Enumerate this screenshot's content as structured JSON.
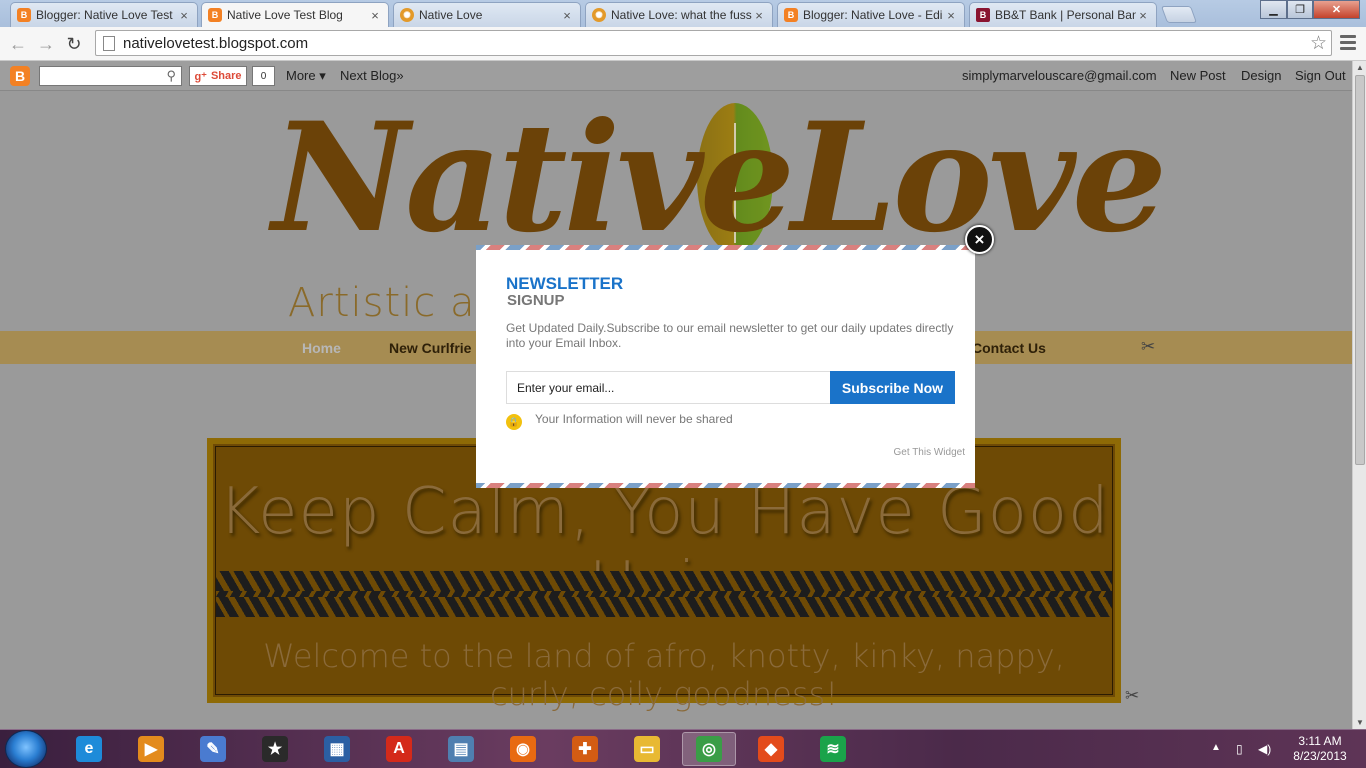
{
  "browser": {
    "tabs": [
      {
        "label": "Blogger: Native Love Test",
        "icon": "blogger-icon",
        "active": false
      },
      {
        "label": "Native Love Test Blog",
        "icon": "blogger-icon",
        "active": true
      },
      {
        "label": "Native Love",
        "icon": "sun-icon",
        "active": false
      },
      {
        "label": "Native Love: what the fuss",
        "icon": "sun-icon",
        "active": false
      },
      {
        "label": "Blogger: Native Love - Edi",
        "icon": "blogger-icon",
        "active": false
      },
      {
        "label": "BB&T Bank | Personal Ban",
        "icon": "bank-icon",
        "active": false
      }
    ],
    "tab_close": "×",
    "url": "nativelovetest.blogspot.com"
  },
  "blogger_bar": {
    "share_label": "Share",
    "share_count": "0",
    "more_label": "More ▾",
    "next_blog_label": "Next Blog»",
    "email": "simplymarvelouscare@gmail.com",
    "new_post_label": "New Post",
    "design_label": "Design",
    "sign_out_label": "Sign Out"
  },
  "blog": {
    "logo_text": "NativeLove",
    "tagline": "Artistic and ... st Hair.",
    "menu": [
      {
        "label": "Home"
      },
      {
        "label": "New Curlfrie"
      },
      {
        "label": "Contact Us"
      }
    ],
    "banner_title": "Keep Calm, You Have Good Hair.",
    "banner_subtitle": "Welcome to the land of afro, knotty, kinky, nappy, curly, coily goodness!"
  },
  "newsletter": {
    "title": "NEWSLETTER",
    "subtitle": "SIGNUP",
    "description": "Get Updated Daily.Subscribe to our email newsletter to get our daily updates directly into your Email Inbox.",
    "email_placeholder": "Enter your email...",
    "subscribe_label": "Subscribe Now",
    "privacy_note": "Your Information will never be shared",
    "get_widget_label": "Get This Widget",
    "close_label": "×"
  },
  "taskbar": {
    "apps": [
      {
        "name": "ie-icon",
        "glyph": "e",
        "color": "#1e8bd9"
      },
      {
        "name": "media-player-icon",
        "glyph": "▶",
        "color": "#e38b1d"
      },
      {
        "name": "paint-icon",
        "glyph": "✎",
        "color": "#4a7bd0"
      },
      {
        "name": "movie-maker-icon",
        "glyph": "★",
        "color": "#2a2a2a"
      },
      {
        "name": "film-icon",
        "glyph": "▦",
        "color": "#2b5fa3"
      },
      {
        "name": "acrobat-icon",
        "glyph": "A",
        "color": "#d42a1a"
      },
      {
        "name": "window-icon",
        "glyph": "▤",
        "color": "#4f7fb0"
      },
      {
        "name": "firefox-icon",
        "glyph": "◉",
        "color": "#e86a12"
      },
      {
        "name": "toolbox-icon",
        "glyph": "✚",
        "color": "#d35c13"
      },
      {
        "name": "explorer-folder-icon",
        "glyph": "▭",
        "color": "#e8b933"
      },
      {
        "name": "chrome-icon",
        "glyph": "◎",
        "color": "#3a9d47"
      },
      {
        "name": "office-icon",
        "glyph": "◆",
        "color": "#e34b1b"
      },
      {
        "name": "spotify-icon",
        "glyph": "≋",
        "color": "#1aa34a"
      }
    ],
    "time": "3:11 AM",
    "date": "8/23/2013"
  }
}
